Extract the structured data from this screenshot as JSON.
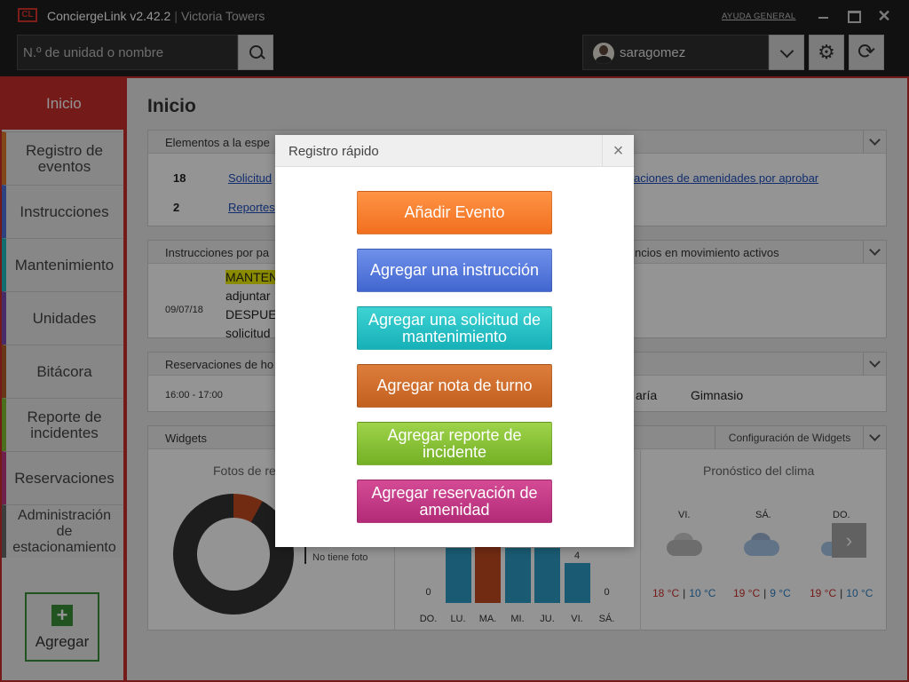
{
  "app": {
    "logo": "CL",
    "name": "ConciergeLink v2.42.2",
    "separator": "|",
    "building": "Victoria Towers",
    "help_label": "AYUDA GENERAL"
  },
  "search": {
    "placeholder": "N.º de unidad o nombre"
  },
  "user": {
    "name": "saragomez"
  },
  "icons": {
    "search": "search-icon",
    "dropdown": "chevron-down-icon",
    "settings": "gear-icon",
    "refresh": "refresh-icon",
    "close": "close-icon",
    "add": "plus-icon",
    "next": "chevron-right-icon"
  },
  "colors": {
    "accent": "#c9302c",
    "event": "#f57a2b",
    "instruction": "#4f72db",
    "maintenance": "#20bcc2",
    "shift_note": "#cc6a28",
    "incident": "#84c034",
    "reservation": "#c23784"
  },
  "sidebar": {
    "items": [
      {
        "label": "Inicio",
        "color": "#c9302c"
      },
      {
        "label": "Registro de eventos",
        "color": "#e07b2a"
      },
      {
        "label": "Instrucciones",
        "color": "#4f72db"
      },
      {
        "label": "Mantenimiento",
        "color": "#20bcc2"
      },
      {
        "label": "Unidades",
        "color": "#7a4db2"
      },
      {
        "label": "Bitácora",
        "color": "#b5602a"
      },
      {
        "label": "Reporte de incidentes",
        "color": "#84c034"
      },
      {
        "label": "Reservaciones",
        "color": "#c23784"
      },
      {
        "label": "Administración de estacionamiento",
        "color": "#6a6a6a"
      }
    ],
    "add_label": "Agregar"
  },
  "main": {
    "title": "Inicio",
    "pending": {
      "title": "Elementos a la espe",
      "rows": [
        {
          "count": "18",
          "link": "Solicitud"
        },
        {
          "count": "2",
          "link": "Reportes"
        }
      ],
      "right_link": "aciones de amenidades por aprobar"
    },
    "instructions": {
      "title": "Instrucciones por pa",
      "right_title": "ncios en movimiento activos",
      "date": "09/07/18",
      "lines": [
        "MANTEN",
        "adjuntar",
        "DESPUE",
        "solicitud"
      ]
    },
    "reservations": {
      "title": "Reservaciones de ho",
      "time": "16:00 - 17:00",
      "cells": [
        "aría",
        "Gimnasio"
      ]
    },
    "widgets": {
      "title": "Widgets",
      "config_label": "Configuración de Widgets",
      "photos": {
        "title": "Fotos de re",
        "legend_top": "",
        "no_photo": "No tiene foto"
      },
      "weather": {
        "title": "Pronóstico del clima",
        "days": [
          {
            "day": "VI.",
            "hi": "18 °C",
            "lo": "10 °C",
            "icon": "rain-cloud-icon"
          },
          {
            "day": "SÁ.",
            "hi": "19 °C",
            "lo": "9 °C",
            "icon": "partly-cloudy-icon"
          },
          {
            "day": "DO.",
            "hi": "19 °C",
            "lo": "10 °C",
            "icon": "sunny-cloud-icon"
          }
        ]
      }
    }
  },
  "chart_data": {
    "type": "bar",
    "categories": [
      "DO.",
      "LU.",
      "MA.",
      "MI.",
      "JU.",
      "VI.",
      "SÁ."
    ],
    "values": [
      0,
      null,
      null,
      null,
      null,
      4,
      0
    ],
    "value_labels": [
      "0",
      "",
      "",
      "",
      "",
      "4",
      "0"
    ],
    "bar_fill": [
      0,
      0.78,
      0.92,
      0.78,
      0.78,
      0.56,
      0
    ],
    "highlight_index": 2,
    "colors": {
      "default": "#2d9ec7",
      "highlight": "#c54b22"
    }
  },
  "modal": {
    "title": "Registro rápido",
    "close": "×",
    "buttons": {
      "event": "Añadir Evento",
      "instruction": "Agregar una instrucción",
      "maintenance": "Agregar una solicitud de mantenimiento",
      "shift_note": "Agregar nota de turno",
      "incident": "Agregar reporte de incidente",
      "reservation": "Agregar reservación de amenidad"
    }
  }
}
